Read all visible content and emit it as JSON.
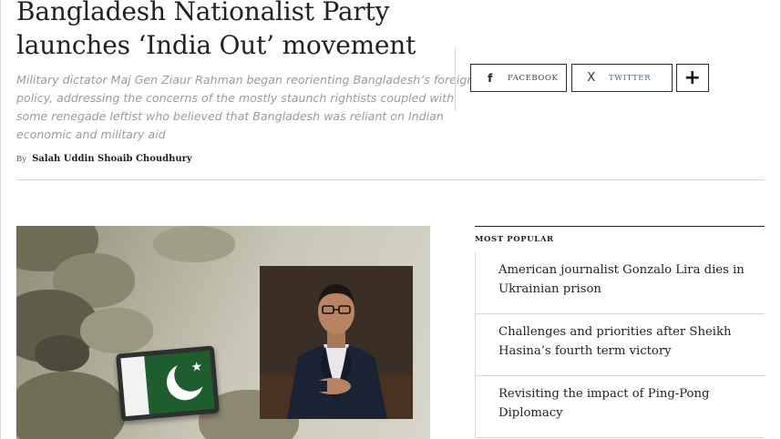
{
  "article": {
    "headline_line1": "Bangladesh Nationalist Party",
    "headline_line2": "launches ‘India Out’ movement",
    "subhead_lines": [
      "Military dictator Maj Gen Ziaur Rahman began reorienting Bangladesh’s foreign",
      "policy, addressing the concerns of the mostly staunch rightists coupled with",
      "some renegade leftist who believed that Bangladesh was reliant on Indian",
      "economic and military aid"
    ],
    "byline_prefix": "By",
    "author": "Salah Uddin Shoaib Choudhury"
  },
  "share": {
    "facebook_label": "FACEBOOK",
    "facebook_icon": "f",
    "twitter_label": "TWITTER",
    "twitter_icon": "X",
    "more_icon": "+"
  },
  "most_popular": {
    "title": "MOST POPULAR",
    "items": [
      {
        "line1": "American journalist Gonzalo Lira dies in",
        "line2": "Ukrainian prison"
      },
      {
        "line1": "Challenges and priorities after Sheikh",
        "line2": "Hasina’s fourth term victory"
      },
      {
        "line1": "Revisiting the impact of Ping-Pong",
        "line2": "Diplomacy"
      }
    ]
  },
  "colors": {
    "pakistan_green": "#1e5e2e",
    "subhead_gray": "#9b9b9b",
    "divider": "#d6d6d6"
  }
}
